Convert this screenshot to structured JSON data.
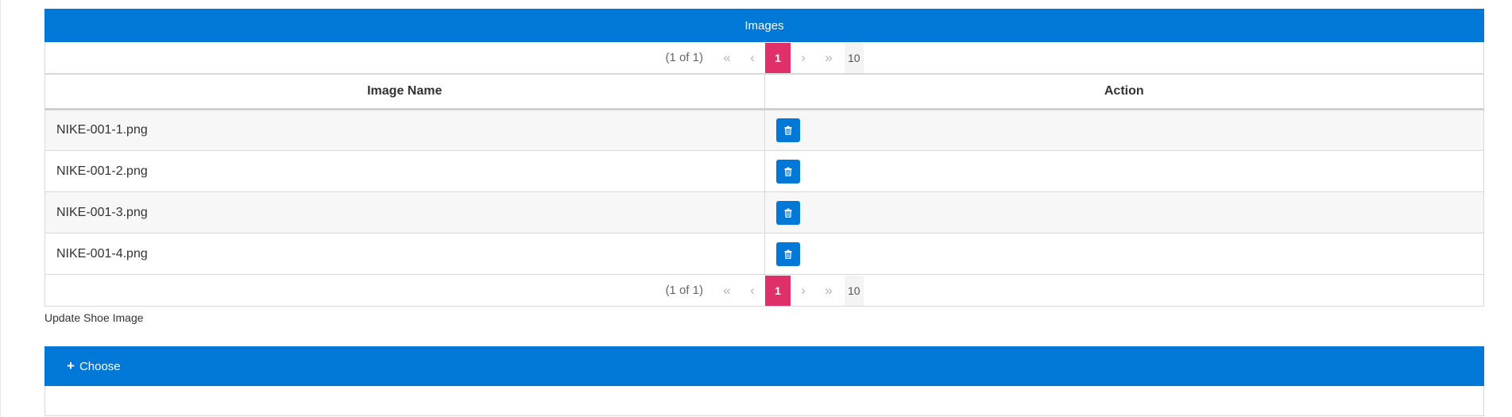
{
  "images_panel": {
    "title": "Images",
    "columns": {
      "name": "Image Name",
      "action": "Action"
    },
    "rows": [
      {
        "name": "NIKE-001-1.png"
      },
      {
        "name": "NIKE-001-2.png"
      },
      {
        "name": "NIKE-001-3.png"
      },
      {
        "name": "NIKE-001-4.png"
      }
    ],
    "paginator": {
      "report": "(1 of 1)",
      "first": "«",
      "prev": "‹",
      "page": "1",
      "next": "›",
      "last": "»",
      "rows_per_page": "10"
    }
  },
  "update_label": "Update Shoe Image",
  "upload": {
    "choose_label": "Choose",
    "plus_icon": "+"
  },
  "colors": {
    "primary": "#0078d7",
    "page_active": "#e0306a"
  },
  "icons": {
    "delete": "trash-icon"
  }
}
